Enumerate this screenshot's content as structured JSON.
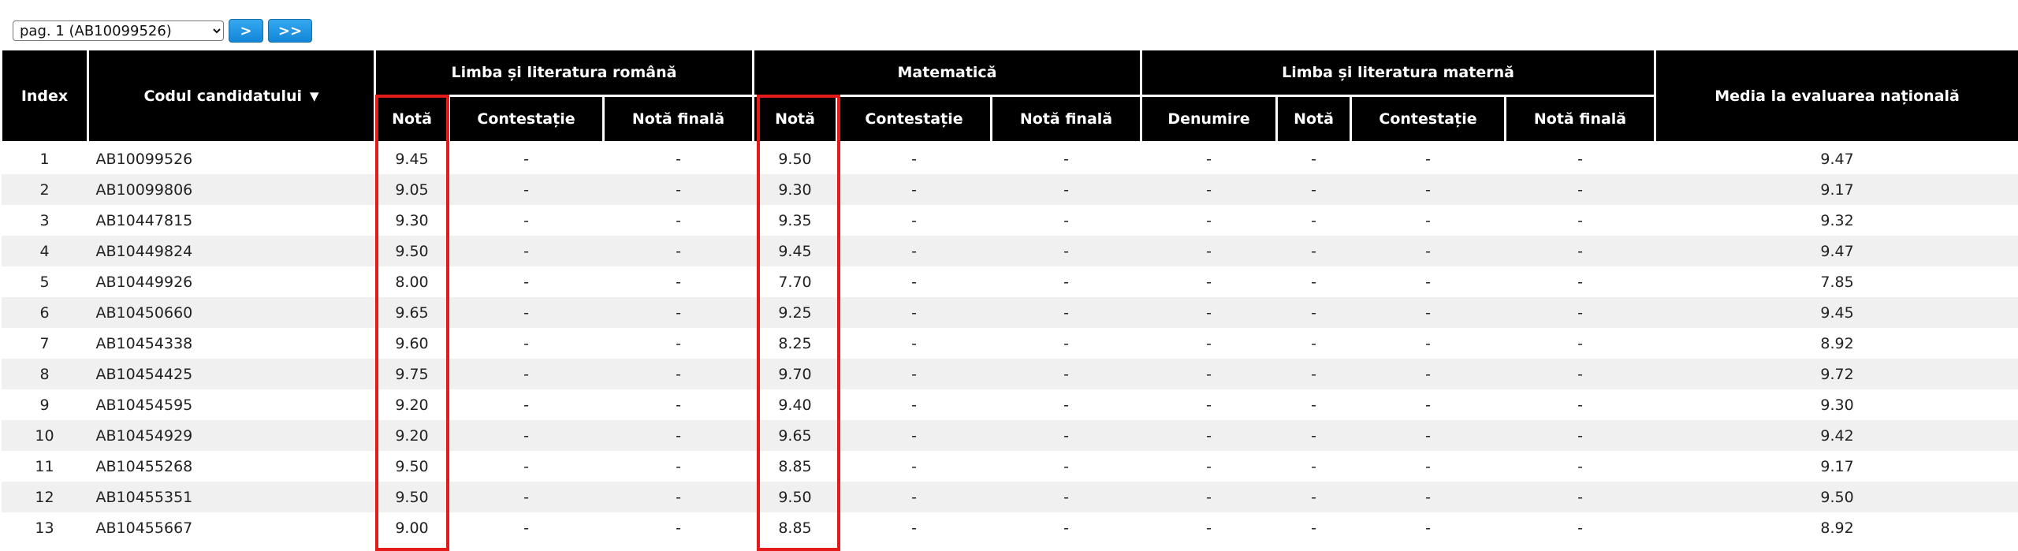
{
  "pager": {
    "selected": "pag. 1 (AB10099526)",
    "next_label": ">",
    "last_label": ">>"
  },
  "header": {
    "index": "Index",
    "code": "Codul candidatului",
    "romana_group": "Limba și literatura română",
    "mate_group": "Matematică",
    "materna_group": "Limba și literatura maternă",
    "media": "Media la evaluarea națională",
    "nota": "Notă",
    "contestatie": "Contestație",
    "nota_finala": "Notă finală",
    "denumire": "Denumire"
  },
  "rows": [
    {
      "index": "1",
      "code": "AB10099526",
      "ro_nota": "9.45",
      "ro_contest": "-",
      "ro_final": "-",
      "mat_nota": "9.50",
      "mat_contest": "-",
      "mat_final": "-",
      "mt_den": "-",
      "mt_nota": "-",
      "mt_contest": "-",
      "mt_final": "-",
      "media": "9.47"
    },
    {
      "index": "2",
      "code": "AB10099806",
      "ro_nota": "9.05",
      "ro_contest": "-",
      "ro_final": "-",
      "mat_nota": "9.30",
      "mat_contest": "-",
      "mat_final": "-",
      "mt_den": "-",
      "mt_nota": "-",
      "mt_contest": "-",
      "mt_final": "-",
      "media": "9.17"
    },
    {
      "index": "3",
      "code": "AB10447815",
      "ro_nota": "9.30",
      "ro_contest": "-",
      "ro_final": "-",
      "mat_nota": "9.35",
      "mat_contest": "-",
      "mat_final": "-",
      "mt_den": "-",
      "mt_nota": "-",
      "mt_contest": "-",
      "mt_final": "-",
      "media": "9.32"
    },
    {
      "index": "4",
      "code": "AB10449824",
      "ro_nota": "9.50",
      "ro_contest": "-",
      "ro_final": "-",
      "mat_nota": "9.45",
      "mat_contest": "-",
      "mat_final": "-",
      "mt_den": "-",
      "mt_nota": "-",
      "mt_contest": "-",
      "mt_final": "-",
      "media": "9.47"
    },
    {
      "index": "5",
      "code": "AB10449926",
      "ro_nota": "8.00",
      "ro_contest": "-",
      "ro_final": "-",
      "mat_nota": "7.70",
      "mat_contest": "-",
      "mat_final": "-",
      "mt_den": "-",
      "mt_nota": "-",
      "mt_contest": "-",
      "mt_final": "-",
      "media": "7.85"
    },
    {
      "index": "6",
      "code": "AB10450660",
      "ro_nota": "9.65",
      "ro_contest": "-",
      "ro_final": "-",
      "mat_nota": "9.25",
      "mat_contest": "-",
      "mat_final": "-",
      "mt_den": "-",
      "mt_nota": "-",
      "mt_contest": "-",
      "mt_final": "-",
      "media": "9.45"
    },
    {
      "index": "7",
      "code": "AB10454338",
      "ro_nota": "9.60",
      "ro_contest": "-",
      "ro_final": "-",
      "mat_nota": "8.25",
      "mat_contest": "-",
      "mat_final": "-",
      "mt_den": "-",
      "mt_nota": "-",
      "mt_contest": "-",
      "mt_final": "-",
      "media": "8.92"
    },
    {
      "index": "8",
      "code": "AB10454425",
      "ro_nota": "9.75",
      "ro_contest": "-",
      "ro_final": "-",
      "mat_nota": "9.70",
      "mat_contest": "-",
      "mat_final": "-",
      "mt_den": "-",
      "mt_nota": "-",
      "mt_contest": "-",
      "mt_final": "-",
      "media": "9.72"
    },
    {
      "index": "9",
      "code": "AB10454595",
      "ro_nota": "9.20",
      "ro_contest": "-",
      "ro_final": "-",
      "mat_nota": "9.40",
      "mat_contest": "-",
      "mat_final": "-",
      "mt_den": "-",
      "mt_nota": "-",
      "mt_contest": "-",
      "mt_final": "-",
      "media": "9.30"
    },
    {
      "index": "10",
      "code": "AB10454929",
      "ro_nota": "9.20",
      "ro_contest": "-",
      "ro_final": "-",
      "mat_nota": "9.65",
      "mat_contest": "-",
      "mat_final": "-",
      "mt_den": "-",
      "mt_nota": "-",
      "mt_contest": "-",
      "mt_final": "-",
      "media": "9.42"
    },
    {
      "index": "11",
      "code": "AB10455268",
      "ro_nota": "9.50",
      "ro_contest": "-",
      "ro_final": "-",
      "mat_nota": "8.85",
      "mat_contest": "-",
      "mat_final": "-",
      "mt_den": "-",
      "mt_nota": "-",
      "mt_contest": "-",
      "mt_final": "-",
      "media": "9.17"
    },
    {
      "index": "12",
      "code": "AB10455351",
      "ro_nota": "9.50",
      "ro_contest": "-",
      "ro_final": "-",
      "mat_nota": "9.50",
      "mat_contest": "-",
      "mat_final": "-",
      "mt_den": "-",
      "mt_nota": "-",
      "mt_contest": "-",
      "mt_final": "-",
      "media": "9.50"
    },
    {
      "index": "13",
      "code": "AB10455667",
      "ro_nota": "9.00",
      "ro_contest": "-",
      "ro_final": "-",
      "mat_nota": "8.85",
      "mat_contest": "-",
      "mat_final": "-",
      "mt_den": "-",
      "mt_nota": "-",
      "mt_contest": "-",
      "mt_final": "-",
      "media": "8.92"
    }
  ],
  "icons": {
    "sort": "sort-down-icon"
  },
  "colors": {
    "header_bg": "#000000",
    "stripe": "#f0f0f0",
    "highlight": "#e31b1b",
    "button": "#1287d8"
  }
}
